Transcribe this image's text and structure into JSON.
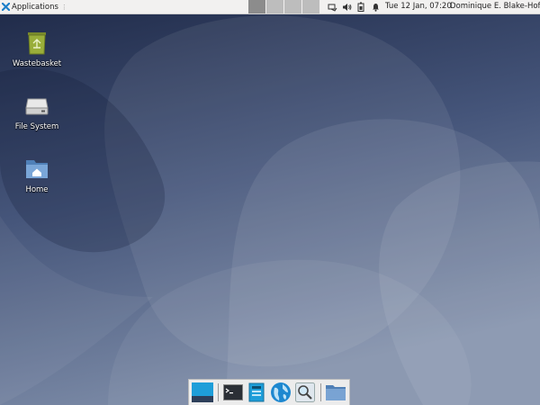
{
  "panel": {
    "applications_label": "Applications",
    "workspaces": [
      {
        "name": "workspace-1",
        "active": true
      },
      {
        "name": "workspace-2",
        "active": false
      },
      {
        "name": "workspace-3",
        "active": false
      },
      {
        "name": "workspace-4",
        "active": false
      }
    ],
    "tray_icons": [
      "network-icon",
      "volume-icon",
      "battery-icon",
      "notification-bell-icon"
    ],
    "clock": "Tue 12 Jan, 07:20",
    "user": "Dominique E. Blake-Hofer"
  },
  "desktop": {
    "icons": [
      {
        "label": "Wastebasket",
        "icon": "trash-icon"
      },
      {
        "label": "File System",
        "icon": "drive-icon"
      },
      {
        "label": "Home",
        "icon": "home-folder-icon"
      }
    ]
  },
  "dock": {
    "items": [
      "show-desktop-icon",
      "terminal-icon",
      "file-manager-icon",
      "web-browser-icon",
      "search-icon",
      "folder-icon"
    ]
  },
  "colors": {
    "wallpaper_dark": "#1f2a47",
    "wallpaper_light": "#8d9cb3",
    "panel_bg": "#f2f1f0",
    "accent_blue": "#1e9ed9"
  }
}
